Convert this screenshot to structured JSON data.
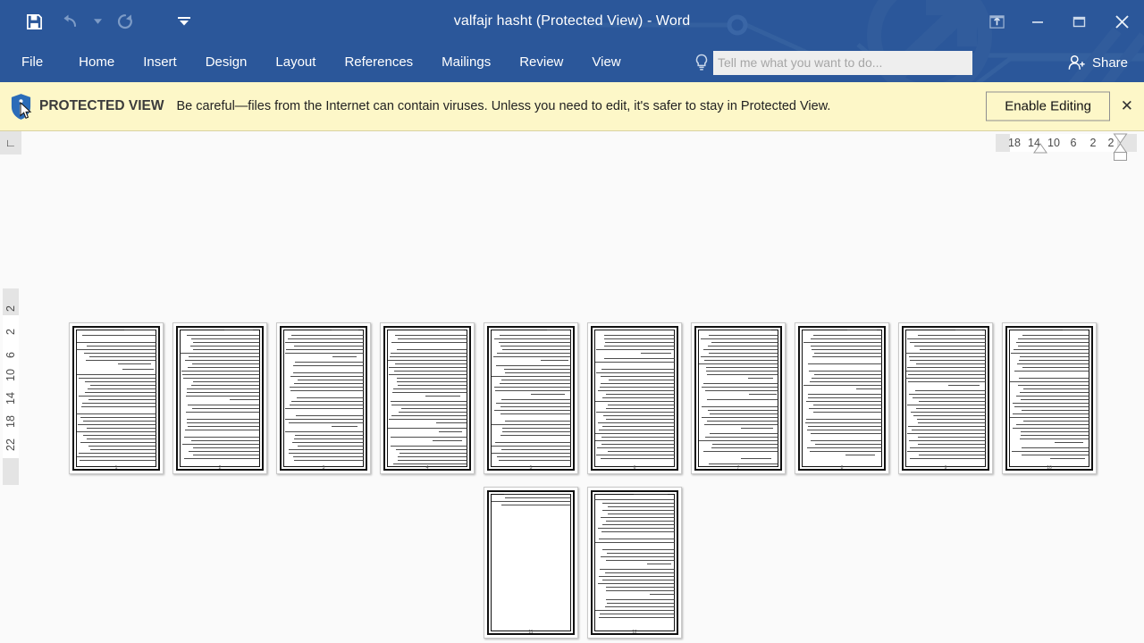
{
  "window": {
    "title": "valfajr hasht (Protected View) - Word",
    "quick_access": [
      {
        "name": "save",
        "icon": "save-icon",
        "label": "Save",
        "enabled": true
      },
      {
        "name": "undo",
        "icon": "undo-icon",
        "label": "Undo",
        "enabled": false
      },
      {
        "name": "undo-dropdown",
        "icon": "chevron-down-icon",
        "label": "Undo options",
        "enabled": false
      },
      {
        "name": "redo",
        "icon": "redo-icon",
        "label": "Repeat",
        "enabled": false
      },
      {
        "name": "customize-qat",
        "icon": "chevron-down-icon",
        "label": "Customize Quick Access Toolbar",
        "enabled": true
      }
    ],
    "controls": [
      {
        "name": "ribbon-display-options",
        "icon": "ribbon-display-icon",
        "label": "Ribbon Display Options"
      },
      {
        "name": "minimize",
        "icon": "minimize-icon",
        "label": "Minimize"
      },
      {
        "name": "restore",
        "icon": "restore-icon",
        "label": "Restore Down"
      },
      {
        "name": "close",
        "icon": "close-icon",
        "label": "Close"
      }
    ]
  },
  "ribbon": {
    "tabs": [
      {
        "label": "File",
        "id": "file"
      },
      {
        "label": "Home",
        "id": "home"
      },
      {
        "label": "Insert",
        "id": "insert"
      },
      {
        "label": "Design",
        "id": "design"
      },
      {
        "label": "Layout",
        "id": "layout"
      },
      {
        "label": "References",
        "id": "references"
      },
      {
        "label": "Mailings",
        "id": "mailings"
      },
      {
        "label": "Review",
        "id": "review"
      },
      {
        "label": "View",
        "id": "view"
      }
    ],
    "tell_me": {
      "placeholder": "Tell me what you want to do...",
      "value": ""
    },
    "share_label": "Share"
  },
  "protected_view": {
    "badge": "PROTECTED VIEW",
    "message": "Be careful—files from the Internet can contain viruses. Unless you need to edit, it's safer to stay in Protected View.",
    "enable_button": "Enable Editing",
    "close_label": "✕"
  },
  "rulers": {
    "horizontal_ticks": [
      "18",
      "14",
      "10",
      "6",
      "2",
      "2"
    ],
    "vertical_ticks": [
      "2",
      "2",
      "6",
      "10",
      "14",
      "18",
      "22"
    ]
  },
  "document": {
    "page_count": 12,
    "rows": [
      {
        "pages": [
          {
            "number": "1",
            "lines": 36,
            "has_heading": true
          },
          {
            "number": "2",
            "lines": 36,
            "has_heading": true
          },
          {
            "number": "3",
            "lines": 36,
            "has_heading": true
          },
          {
            "number": "4",
            "lines": 36,
            "has_heading": true
          },
          {
            "number": "5",
            "lines": 36,
            "has_heading": true
          },
          {
            "number": "6",
            "lines": 36,
            "has_heading": true
          },
          {
            "number": "7",
            "lines": 36,
            "has_heading": true
          },
          {
            "number": "8",
            "lines": 36,
            "has_heading": true
          },
          {
            "number": "9",
            "lines": 36,
            "has_heading": true
          },
          {
            "number": "10",
            "lines": 36,
            "has_heading": true
          }
        ]
      },
      {
        "pages": [
          {
            "number": "11",
            "lines": 4,
            "has_heading": false
          },
          {
            "number": "12",
            "lines": 34,
            "has_heading": true
          }
        ]
      }
    ]
  },
  "colors": {
    "title_bar": "#2b579a",
    "ribbon": "#2b579a",
    "protected_bar": "#fdf7c8",
    "workspace": "#fafafa",
    "accent_text": "#ffffff"
  }
}
